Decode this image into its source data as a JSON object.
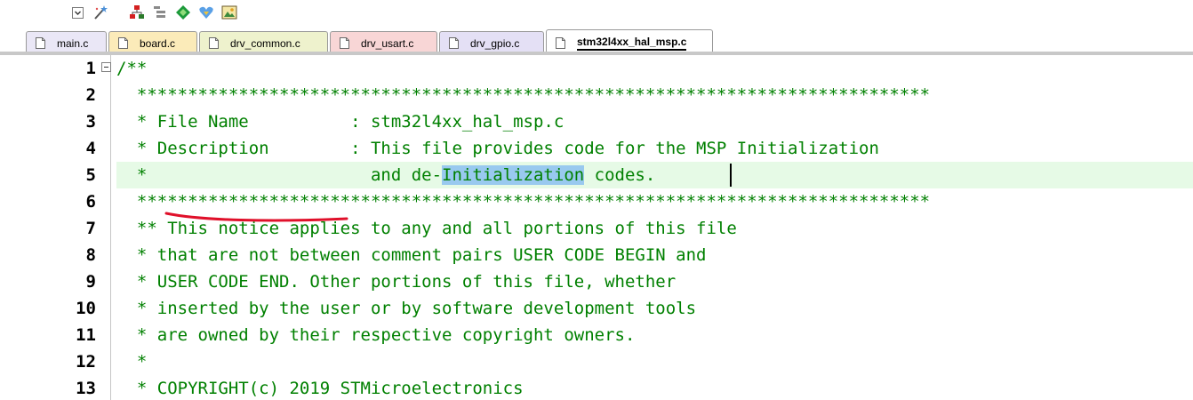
{
  "toolbar": {
    "icons": [
      "checkbox-dropdown-icon",
      "magic-wand-icon",
      "hierarchy-icon",
      "list-icon",
      "diamond-icon",
      "heart-icon",
      "image-icon"
    ]
  },
  "tabs": [
    {
      "label": "main.c",
      "color": "#eae7f6",
      "active": false
    },
    {
      "label": "board.c",
      "color": "#fbebb9",
      "active": false
    },
    {
      "label": "drv_common.c",
      "color": "#eef2cd",
      "active": false
    },
    {
      "label": "drv_usart.c",
      "color": "#f8d6d6",
      "active": false
    },
    {
      "label": "drv_gpio.c",
      "color": "#e4e0f5",
      "active": false
    },
    {
      "label": "stm32l4xx_hal_msp.c",
      "color": "#ffffff",
      "active": true
    }
  ],
  "editor": {
    "lines": [
      {
        "num": "1",
        "text": "/**"
      },
      {
        "num": "2",
        "text": "  ******************************************************************************"
      },
      {
        "num": "3",
        "text": "  * File Name          : stm32l4xx_hal_msp.c"
      },
      {
        "num": "4",
        "text": "  * Description        : This file provides code for the MSP Initialization"
      },
      {
        "num": "5",
        "text_before": "  *                      and de-",
        "selected": "Initialization",
        "text_after": " codes."
      },
      {
        "num": "6",
        "text": "  ******************************************************************************"
      },
      {
        "num": "7",
        "text": "  ** This notice applies to any and all portions of this file"
      },
      {
        "num": "8",
        "text": "  * that are not between comment pairs USER CODE BEGIN and"
      },
      {
        "num": "9",
        "text": "  * USER CODE END. Other portions of this file, whether"
      },
      {
        "num": "10",
        "text": "  * inserted by the user or by software development tools"
      },
      {
        "num": "11",
        "text": "  * are owned by their respective copyright owners."
      },
      {
        "num": "12",
        "text": "  *"
      },
      {
        "num": "13",
        "text": "  * COPYRIGHT(c) 2019 STMicroelectronics"
      }
    ],
    "highlighted_line": "5",
    "comment_color": "#008000",
    "selection_color": "#99c9ef",
    "annotation_color": "#e0102a"
  }
}
